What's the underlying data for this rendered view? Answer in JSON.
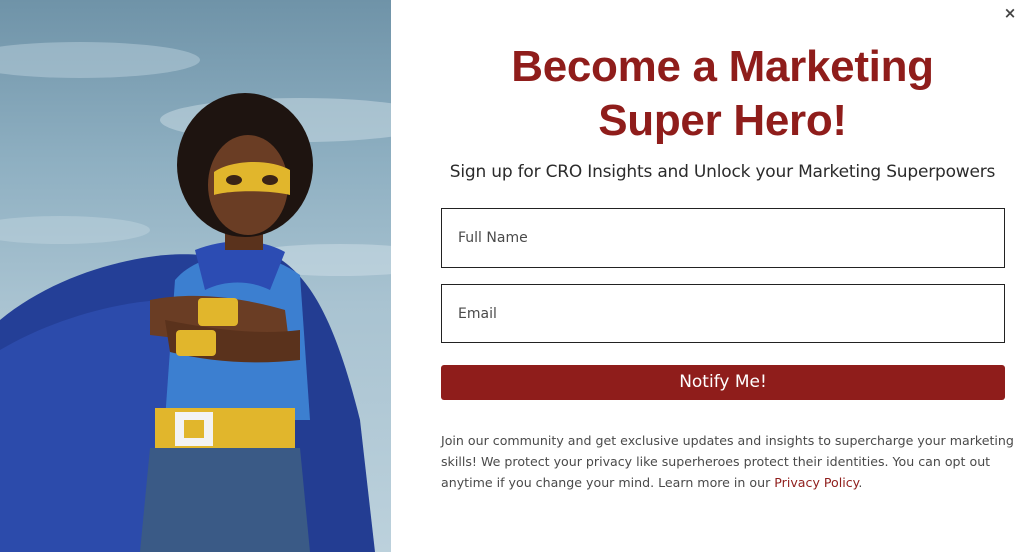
{
  "popup": {
    "close_icon": "×",
    "headline_line1": "Become a Marketing",
    "headline_line2": "Super Hero!",
    "subheadline": "Sign up for CRO Insights and Unlock your Marketing Superpowers",
    "form": {
      "name_placeholder": "Full Name",
      "name_value": "",
      "email_placeholder": "Email",
      "email_value": "",
      "submit_label": "Notify Me!"
    },
    "disclaimer": {
      "text": "Join our community and get exclusive updates and insights to supercharge your marketing skills! We protect your privacy like superheroes protect their identities. You can opt out anytime if you change your mind. Learn more in our ",
      "link_text": "Privacy Policy",
      "trailing": "."
    },
    "image": {
      "subject": "child in superhero mask and cape against sky"
    }
  },
  "colors": {
    "brand": "#8f1d1b",
    "text": "#2b2b2b",
    "cape": "#2a49a8",
    "mask": "#e1b62c"
  },
  "icons": {
    "close": "close-icon"
  }
}
